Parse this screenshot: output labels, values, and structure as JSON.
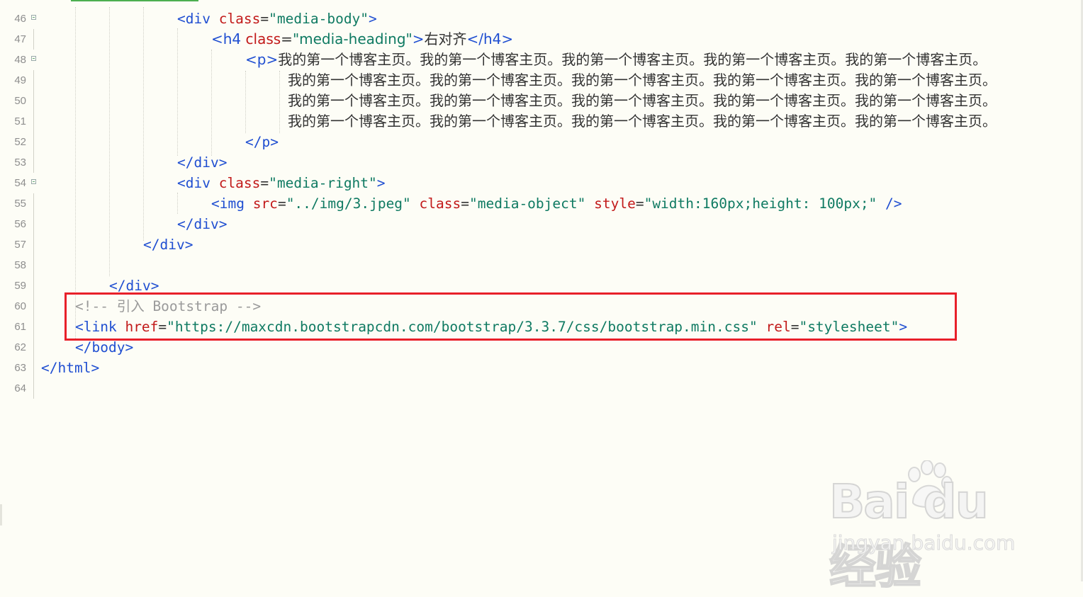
{
  "editor": {
    "lines": [
      {
        "num": "46",
        "fold": true,
        "indent": 250,
        "tokens": [
          [
            "tag",
            "<div "
          ],
          [
            "attr",
            "class"
          ],
          [
            "txt",
            "="
          ],
          [
            "str",
            "\"media-body\""
          ],
          [
            "tag",
            ">"
          ]
        ]
      },
      {
        "num": "47",
        "fold": false,
        "indent": 298,
        "tokens": [
          [
            "tag",
            "<h4 "
          ],
          [
            "attr",
            "class"
          ],
          [
            "txt",
            "="
          ],
          [
            "str",
            "\"media-heading\""
          ],
          [
            "tag",
            ">"
          ],
          [
            "txt",
            "右对齐"
          ],
          [
            "tag",
            "</h4>"
          ]
        ]
      },
      {
        "num": "48",
        "fold": true,
        "indent": 346,
        "tokens": [
          [
            "tag",
            "<p>"
          ],
          [
            "txt",
            "我的第一个博客主页。我的第一个博客主页。我的第一个博客主页。我的第一个博客主页。我的第一个博客主页。"
          ]
        ]
      },
      {
        "num": "49",
        "fold": false,
        "indent": 406,
        "tokens": [
          [
            "txt",
            "我的第一个博客主页。我的第一个博客主页。我的第一个博客主页。我的第一个博客主页。我的第一个博客主页。"
          ]
        ]
      },
      {
        "num": "50",
        "fold": false,
        "indent": 406,
        "tokens": [
          [
            "txt",
            "我的第一个博客主页。我的第一个博客主页。我的第一个博客主页。我的第一个博客主页。我的第一个博客主页。"
          ]
        ]
      },
      {
        "num": "51",
        "fold": false,
        "indent": 406,
        "tokens": [
          [
            "txt",
            "我的第一个博客主页。我的第一个博客主页。我的第一个博客主页。我的第一个博客主页。我的第一个博客主页。"
          ]
        ]
      },
      {
        "num": "52",
        "fold": false,
        "indent": 346,
        "tokens": [
          [
            "tag",
            "</p>"
          ]
        ]
      },
      {
        "num": "53",
        "fold": false,
        "indent": 250,
        "tokens": [
          [
            "tag",
            "</div>"
          ]
        ]
      },
      {
        "num": "54",
        "fold": true,
        "indent": 250,
        "tokens": [
          [
            "tag",
            "<div "
          ],
          [
            "attr",
            "class"
          ],
          [
            "txt",
            "="
          ],
          [
            "str",
            "\"media-right\""
          ],
          [
            "tag",
            ">"
          ]
        ]
      },
      {
        "num": "55",
        "fold": false,
        "indent": 298,
        "tokens": [
          [
            "tag",
            "<img "
          ],
          [
            "attr",
            "src"
          ],
          [
            "txt",
            "="
          ],
          [
            "str",
            "\"../img/3.jpeg\""
          ],
          [
            "txt",
            " "
          ],
          [
            "attr",
            "class"
          ],
          [
            "txt",
            "="
          ],
          [
            "str",
            "\"media-object\""
          ],
          [
            "txt",
            " "
          ],
          [
            "attr",
            "style"
          ],
          [
            "txt",
            "="
          ],
          [
            "str",
            "\"width:160px;height: 100px;\""
          ],
          [
            "tag",
            " />"
          ]
        ]
      },
      {
        "num": "56",
        "fold": false,
        "indent": 250,
        "tokens": [
          [
            "tag",
            "</div>"
          ]
        ]
      },
      {
        "num": "57",
        "fold": false,
        "indent": 202,
        "tokens": [
          [
            "tag",
            "</div>"
          ]
        ]
      },
      {
        "num": "58",
        "fold": false,
        "indent": 202,
        "tokens": []
      },
      {
        "num": "59",
        "fold": false,
        "indent": 154,
        "tokens": [
          [
            "tag",
            "</div>"
          ]
        ]
      },
      {
        "num": "60",
        "fold": false,
        "indent": 106,
        "tokens": [
          [
            "cmt",
            "<!-- 引入 Bootstrap -->"
          ]
        ]
      },
      {
        "num": "61",
        "fold": false,
        "indent": 106,
        "tokens": [
          [
            "tag",
            "<link "
          ],
          [
            "attr",
            "href"
          ],
          [
            "txt",
            "="
          ],
          [
            "str",
            "\"https://maxcdn.bootstrapcdn.com/bootstrap/3.3.7/css/bootstrap.min.css\""
          ],
          [
            "txt",
            " "
          ],
          [
            "attr",
            "rel"
          ],
          [
            "txt",
            "="
          ],
          [
            "str",
            "\"stylesheet\""
          ],
          [
            "tag",
            ">"
          ]
        ]
      },
      {
        "num": "62",
        "fold": false,
        "indent": 106,
        "tokens": [
          [
            "tag",
            "</body>"
          ]
        ]
      },
      {
        "num": "63",
        "fold": false,
        "indent": 58,
        "tokens": [
          [
            "tag",
            "</html>"
          ]
        ]
      },
      {
        "num": "64",
        "fold": false,
        "indent": 58,
        "tokens": []
      }
    ]
  },
  "watermark": {
    "logo": "Bai du 经验",
    "url": "jingyan.baidu.com"
  },
  "colors": {
    "tag": "#1f4ed1",
    "attribute": "#c21a1a",
    "string": "#0f7a62",
    "comment": "#9a9a9a",
    "highlight_box": "#e8202a",
    "background": "#fdfdf6"
  }
}
